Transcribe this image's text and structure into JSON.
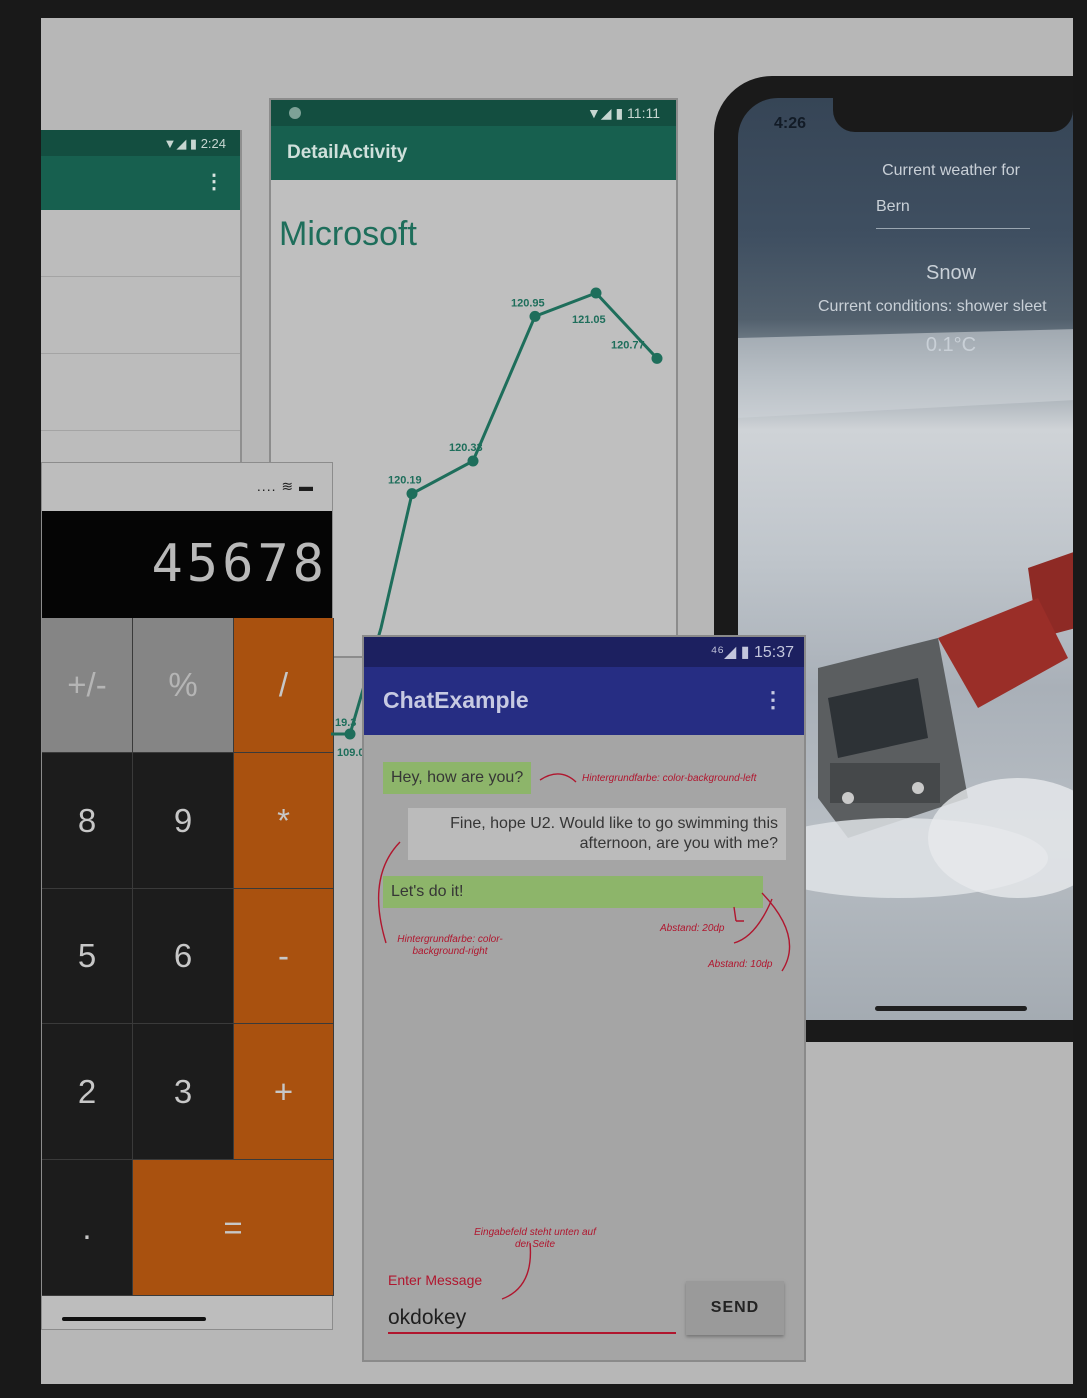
{
  "list_phone": {
    "status_text": "▼◢ ▮ 2:24",
    "menu_icon": "more-vert-icon"
  },
  "detail_phone": {
    "status_text": "▼◢ ▮ 11:11",
    "title": "DetailActivity",
    "stock_name": "Microsoft"
  },
  "chart_data": {
    "type": "line",
    "title": "Microsoft",
    "points": [
      {
        "x": 1,
        "y": 120.19,
        "label": "120.19"
      },
      {
        "x": 2,
        "y": 120.33,
        "label": "120.33"
      },
      {
        "x": 3,
        "y": 120.95,
        "label": "120.95"
      },
      {
        "x": 4,
        "y": 121.05,
        "label": "121.05"
      },
      {
        "x": 5,
        "y": 120.77,
        "label": "120.77"
      }
    ],
    "partial_labels": [
      "109.0",
      "19.3"
    ],
    "color": "#1e6e5b"
  },
  "weather_phone": {
    "time": "4:26",
    "heading": "Current weather for",
    "city": "Bern",
    "condition": "Snow",
    "details": "Current conditions: shower sleet",
    "temperature": "0.1°C"
  },
  "calculator": {
    "status_text": ".... ≋ ▬",
    "display": "45678",
    "keys": [
      {
        "label": "+/-",
        "style": "grey"
      },
      {
        "label": "%",
        "style": "grey"
      },
      {
        "label": "/",
        "style": "orange"
      },
      {
        "label": "8",
        "style": "dark"
      },
      {
        "label": "9",
        "style": "dark"
      },
      {
        "label": "*",
        "style": "orange"
      },
      {
        "label": "5",
        "style": "dark"
      },
      {
        "label": "6",
        "style": "dark"
      },
      {
        "label": "-",
        "style": "orange"
      },
      {
        "label": "2",
        "style": "dark"
      },
      {
        "label": "3",
        "style": "dark"
      },
      {
        "label": "+",
        "style": "orange"
      },
      {
        "label": ".",
        "style": "dark"
      },
      {
        "label": "=",
        "style": "orange"
      }
    ]
  },
  "chat": {
    "status_text": "⁴⁶◢ ▮ 15:37",
    "title": "ChatExample",
    "messages": [
      {
        "side": "left",
        "text": "Hey, how are you?"
      },
      {
        "side": "right",
        "text": "Fine, hope U2. Would like to go swimming this afternoon, are you with me?"
      },
      {
        "side": "left",
        "text": "Let's do it!"
      }
    ],
    "annotations": {
      "bg_left": "Hintergrundfarbe: color-background-left",
      "bg_right": "Hintergrundfarbe: color-background-right",
      "padding_20": "Abstand: 20dp",
      "padding_10": "Abstand: 10dp",
      "input_note": "Eingabefeld steht unten auf der Seite"
    },
    "input_hint": "Enter Message",
    "input_value": "okdokey",
    "send_label": "SEND"
  }
}
